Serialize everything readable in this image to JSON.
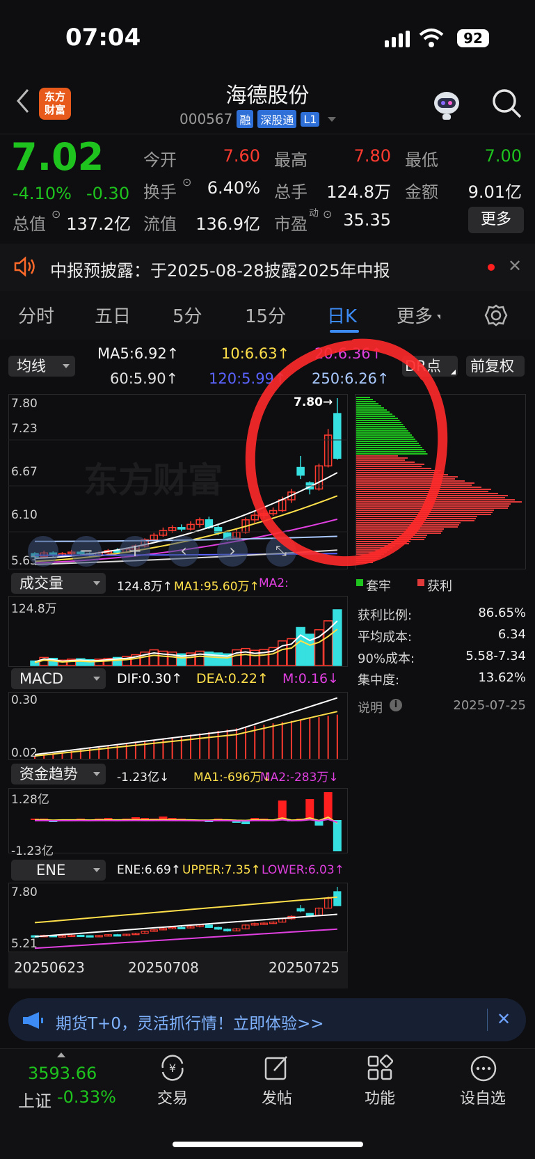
{
  "status": {
    "time": "07:04",
    "battery": "92"
  },
  "header": {
    "logo": "东方\n财富",
    "stock_name": "海德股份",
    "stock_code": "000567",
    "tags": [
      "融",
      "深股通",
      "L1"
    ]
  },
  "quote": {
    "price": "7.02",
    "change_pct": "-4.10%",
    "change_abs": "-0.30",
    "fields": [
      {
        "label": "今开",
        "value": "7.60",
        "color": "#ff3b30"
      },
      {
        "label": "最高",
        "value": "7.80",
        "color": "#ff3b30"
      },
      {
        "label": "最低",
        "value": "7.00",
        "color": "#1ec31e"
      },
      {
        "label": "换手",
        "value": "6.40%",
        "color": "#f2f2f2"
      },
      {
        "label": "总手",
        "value": "124.8万",
        "color": "#f2f2f2"
      },
      {
        "label": "金额",
        "value": "9.01亿",
        "color": "#f2f2f2"
      },
      {
        "label": "总值",
        "value": "137.2亿",
        "color": "#f2f2f2"
      },
      {
        "label": "流值",
        "value": "136.9亿",
        "color": "#f2f2f2"
      },
      {
        "label": "市盈",
        "value": "35.35",
        "color": "#f2f2f2"
      }
    ],
    "pe_sup": "动",
    "more_label": "更多"
  },
  "notice": {
    "text": "中报预披露：于2025-08-28披露2025年中报"
  },
  "tabs": [
    "分时",
    "五日",
    "5分",
    "15分",
    "日K",
    "更多"
  ],
  "active_tab": "日K",
  "kline": {
    "ma_button": "均线",
    "ma_values": [
      "MA5:6.92↑",
      "10:6.63↑",
      "20:6.36↑",
      "60:5.90↑",
      "120:5.99↑",
      "250:6.26↑"
    ],
    "dr_button": "DR点",
    "fq_button": "前复权",
    "y_top": "7.80",
    "y_mid1": "7.23",
    "y_mid2": "6.67",
    "y_mid3": "6.10",
    "y_bottom": "5.63",
    "high_marker": "7.80→"
  },
  "volume": {
    "button": "成交量",
    "values": [
      "124.8万↑",
      "MA1:95.60万↑",
      "MA2:"
    ],
    "y_top": "124.8万"
  },
  "chip": {
    "legend": [
      "套牢",
      "获利"
    ],
    "rows": [
      {
        "label": "获利比例:",
        "value": "86.65%"
      },
      {
        "label": "平均成本:",
        "value": "6.34"
      },
      {
        "label": "90%成本:",
        "value": "5.58-7.34"
      },
      {
        "label": "集中度:",
        "value": "13.62%"
      }
    ],
    "note": "说明",
    "date": "2025-07-25"
  },
  "macd": {
    "button": "MACD",
    "values": [
      "DIF:0.30↑",
      "DEA:0.22↑",
      "M:0.16↓"
    ],
    "y_top": "0.30",
    "y_bottom": "0.02"
  },
  "fund": {
    "button": "资金趋势",
    "values": [
      "-1.23亿↓",
      "MA1:-696万↓",
      "MA2:-283万↓"
    ],
    "y_top": "1.28亿",
    "y_bottom": "-1.23亿"
  },
  "ene": {
    "button": "ENE",
    "values": [
      "ENE:6.69↑",
      "UPPER:7.35↑",
      "LOWER:6.03↑"
    ],
    "y_top": "7.80",
    "y_bottom": "5.21",
    "dates": [
      "20250623",
      "20250708",
      "20250725"
    ]
  },
  "ad": {
    "text": "期货T+0，灵活抓行情！立即体验>>"
  },
  "bottom_nav": {
    "index_value": "3593.66",
    "index_name": "上证",
    "index_change": "-0.33%",
    "items": [
      "交易",
      "发帖",
      "功能",
      "设自选"
    ]
  },
  "colors": {
    "up": "#ff3b30",
    "down": "#36e0e0",
    "green": "#1ec31e",
    "accent": "#3d8cf5"
  }
}
